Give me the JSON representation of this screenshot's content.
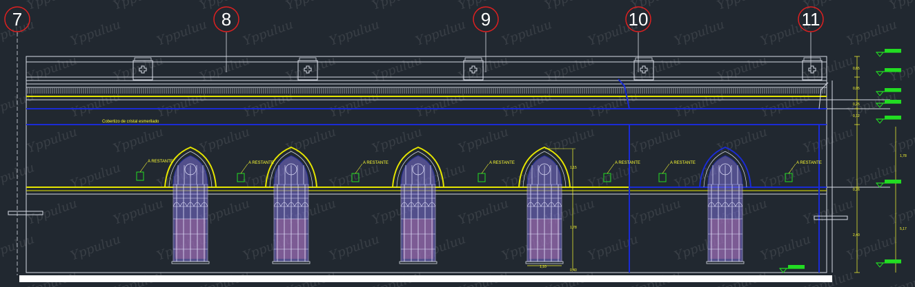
{
  "colors": {
    "background": "#212830",
    "white_line": "#d8dce6",
    "blue_line": "#1a2bd6",
    "yellow_line": "#e6e600",
    "green_mark": "#22dd22",
    "axis_circle": "#e02020",
    "window_fill": "#7a6fd6",
    "window_lower": "#b06aa0"
  },
  "axes": [
    {
      "label": "7"
    },
    {
      "label": "8"
    },
    {
      "label": "9"
    },
    {
      "label": "10"
    },
    {
      "label": "11"
    }
  ],
  "wall_tags": [
    {
      "label": "A RESTANTE"
    },
    {
      "label": "A RESTANTE"
    },
    {
      "label": "A RESTANTE"
    },
    {
      "label": "A RESTANTE"
    },
    {
      "label": "A RESTANTE"
    },
    {
      "label": "A RESTANTE"
    },
    {
      "label": "A RESTANTE"
    }
  ],
  "note_text": "Cobertizo de cristal esmerilado",
  "level_dims": [
    "0,65",
    "0,05",
    "0,25",
    "0,12",
    "1,78",
    "0,26",
    "2,40",
    "5,17"
  ],
  "window_dims": {
    "arch": "1,15",
    "height": "1,78",
    "bottom": "0,40",
    "width": "1,10"
  },
  "watermark": "Yppuluu",
  "icons": [
    "cross-ornament-icon",
    "level-marker-icon"
  ]
}
